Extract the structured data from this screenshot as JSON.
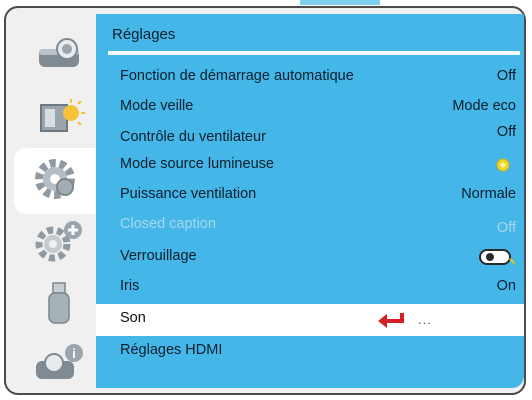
{
  "menu": {
    "title": "Réglages",
    "colors": {
      "panel": "#44b6e8",
      "frame": "#4b4b4b",
      "arrow": "#d31f26",
      "bulb": "#f1d42a"
    },
    "sidebar": [
      {
        "icon": "projector-image-icon"
      },
      {
        "icon": "display-settings-icon"
      },
      {
        "icon": "gear-settings-icon",
        "active": true
      },
      {
        "icon": "advanced-gear-icon"
      },
      {
        "icon": "usb-stick-icon"
      },
      {
        "icon": "projector-info-icon"
      }
    ],
    "rows": [
      {
        "label": "Fonction de démarrage automatique",
        "value": "Off"
      },
      {
        "label": "Mode veille",
        "value": "Mode eco"
      },
      {
        "label": "Contrôle du ventilateur",
        "value": "Off"
      },
      {
        "label": "Mode source lumineuse",
        "value_icon": "light-bulb-icon"
      },
      {
        "label": "Puissance ventilation",
        "value": "Normale"
      },
      {
        "label": "Closed caption",
        "value": "Off",
        "disabled": true
      },
      {
        "label": "Verrouillage",
        "value_icon": "lock-toggle-icon"
      },
      {
        "label": "Iris",
        "value": "On"
      },
      {
        "label": "Son",
        "value": "...",
        "selected": true,
        "marker_icon": "enter-arrow-icon"
      },
      {
        "label": "Réglages HDMI",
        "value": ""
      }
    ]
  }
}
